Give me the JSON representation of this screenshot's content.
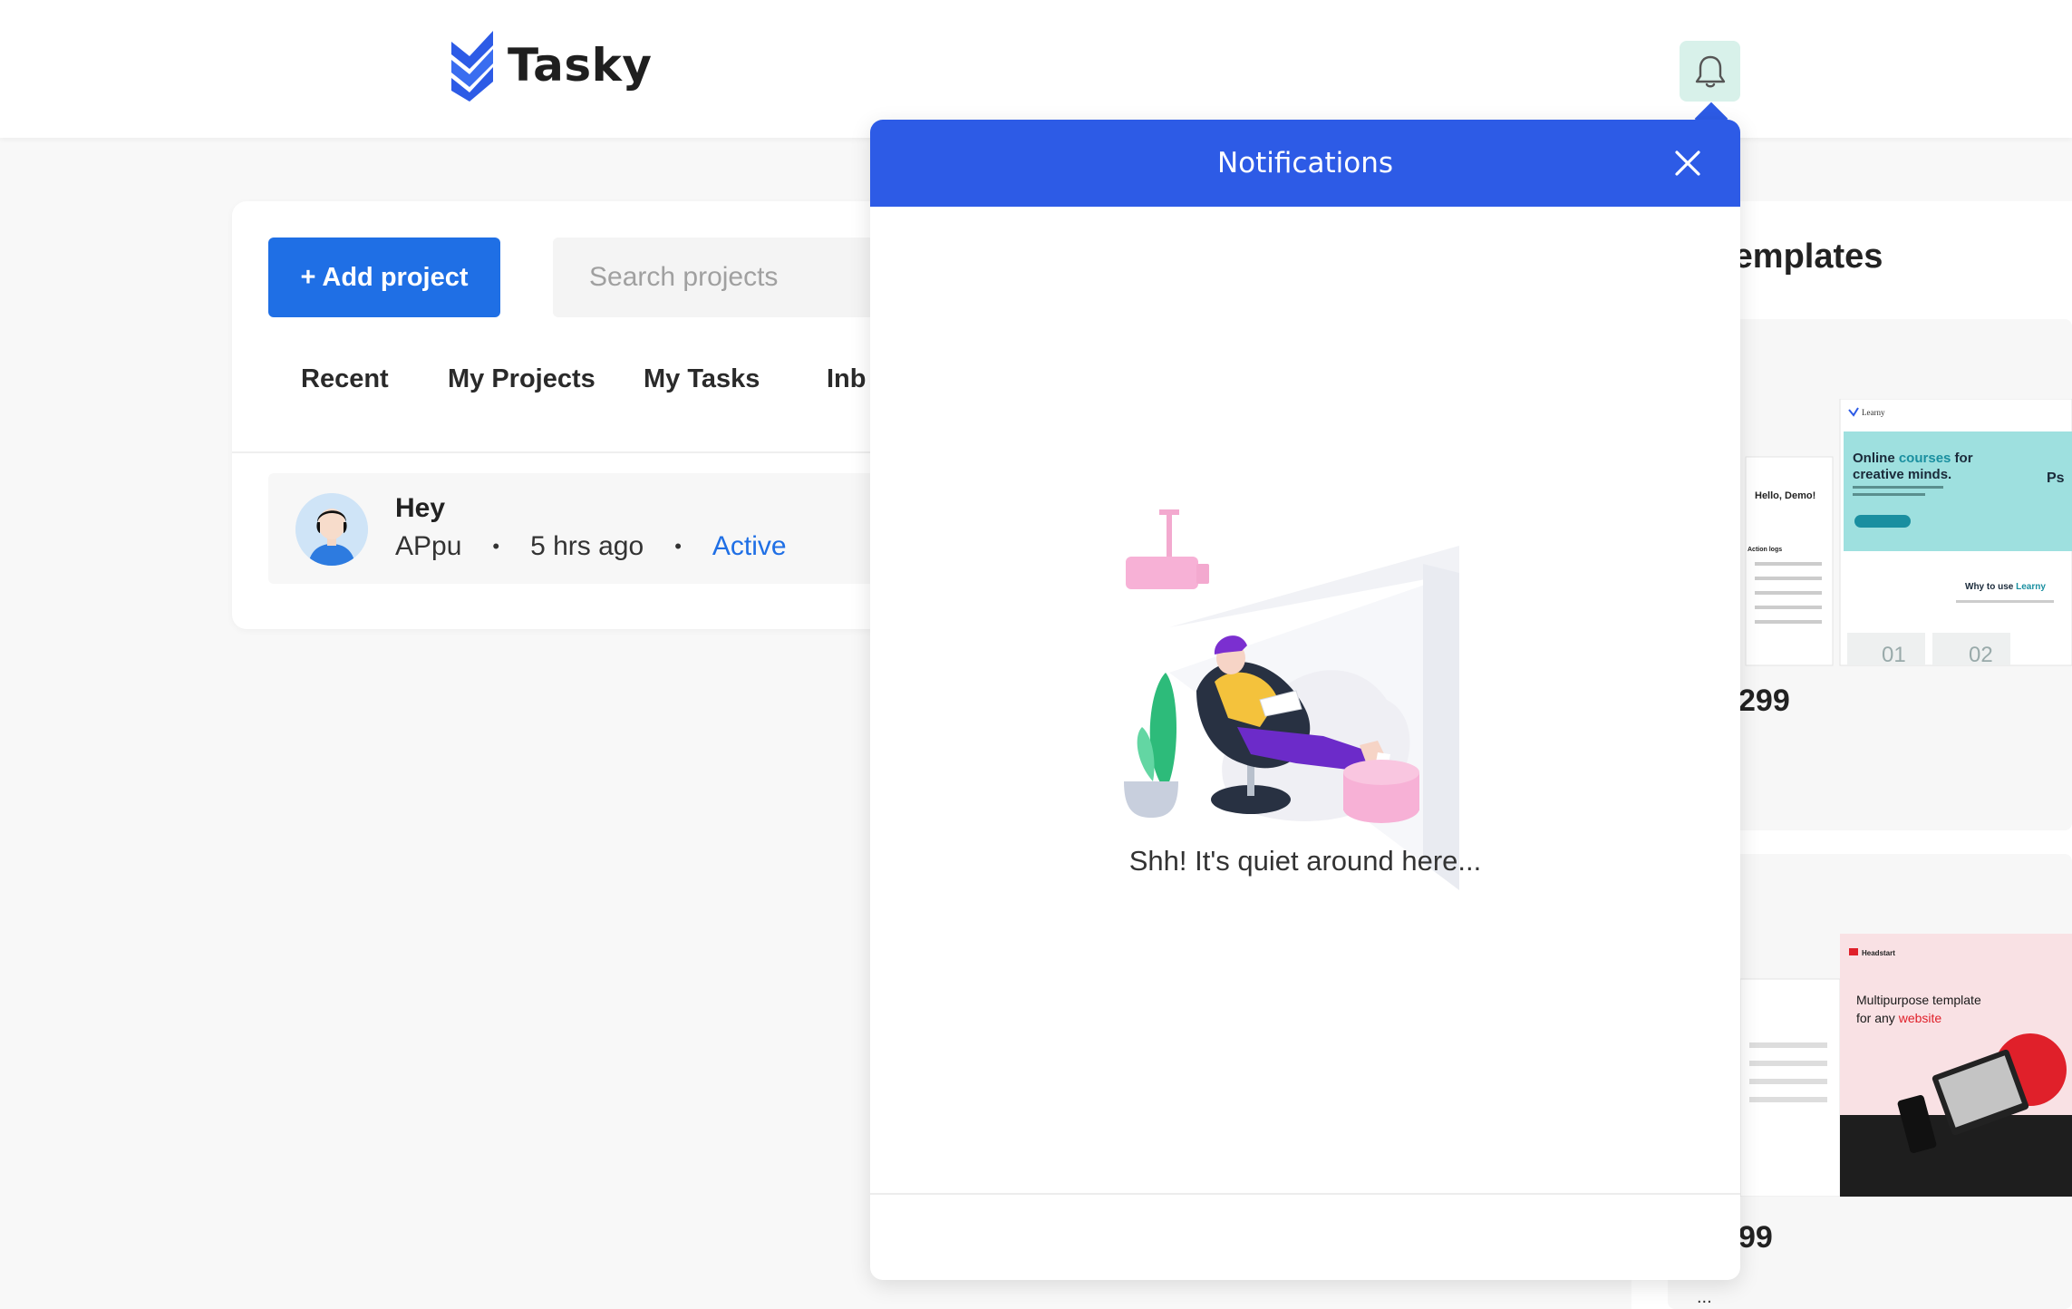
{
  "header": {
    "app_name": "Tasky",
    "logo_icon": "tasky-logo-chevrons",
    "notification_icon": "bell-icon"
  },
  "toolbar": {
    "add_label": "+ Add project",
    "search_placeholder": "Search projects"
  },
  "tabs": [
    "Recent",
    "My Projects",
    "My Tasks",
    "Inb"
  ],
  "project_row": {
    "title": "Hey",
    "user": "APpu",
    "time": "5 hrs ago",
    "status": "Active"
  },
  "templates": {
    "title": "templates",
    "price1": "299",
    "price2": "99",
    "preview1": {
      "brand": "Learny",
      "greeting": "Hello, Demo!",
      "headline_a": "Online ",
      "headline_b": "courses",
      "headline_c": " for",
      "headline_d": "creative minds.",
      "why": "Why to use ",
      "why_brand": "Learny",
      "logs": "Action logs",
      "ps": "Ps",
      "n1": "01",
      "n2": "02"
    },
    "preview2": {
      "brand": "Headstart",
      "line1": "Multipurpose template",
      "line2a": "for any ",
      "line2b": "website"
    },
    "more": "..."
  },
  "notifications": {
    "title": "Notifications",
    "close_icon": "close-icon",
    "empty_message": "Shh! It's quiet around here..."
  },
  "colors": {
    "primary": "#1f6fe5",
    "panel_header": "#2d5be6",
    "bell_bg": "#d8f1ea"
  }
}
